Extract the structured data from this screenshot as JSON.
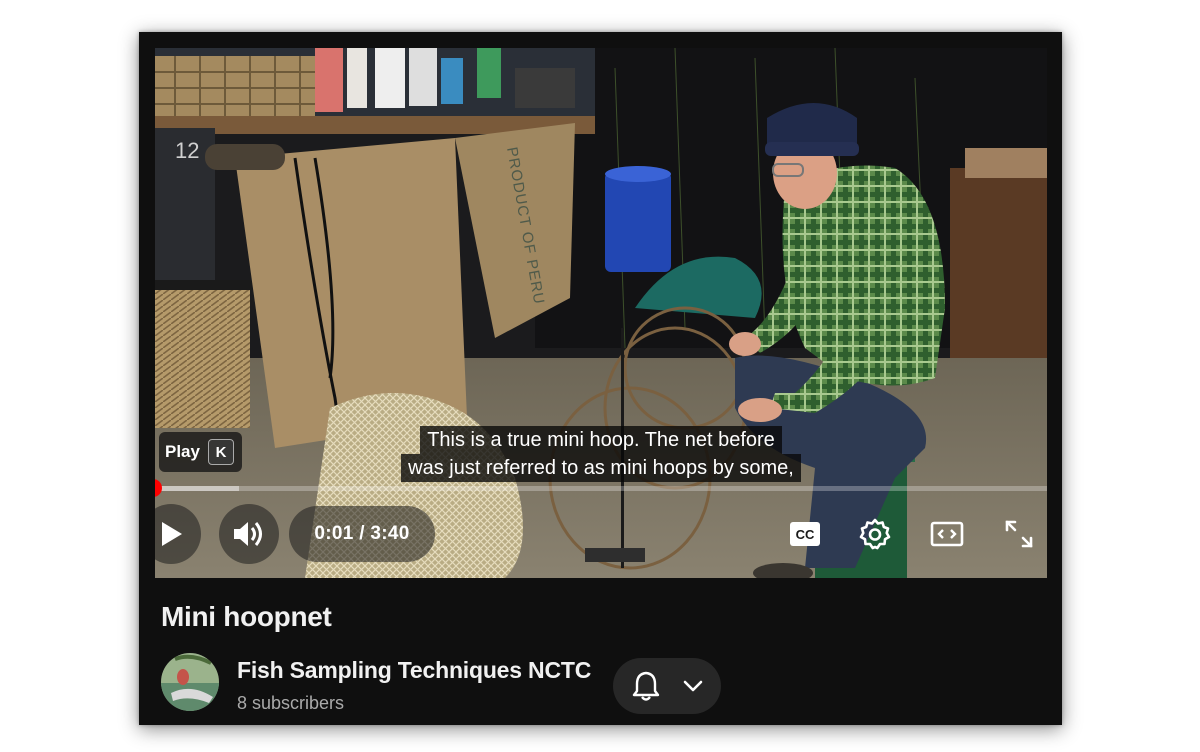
{
  "player": {
    "tooltip": {
      "label": "Play",
      "shortcut": "K"
    },
    "captions": [
      "This is a true mini hoop. The net before",
      "was just referred to as mini hoops by some,"
    ],
    "time": {
      "current": "0:01",
      "duration": "3:40",
      "display": "0:01 / 3:40"
    },
    "progress_fraction": 0.004,
    "buffered_fraction": 0.1,
    "accent_color": "#ff0000",
    "controls": [
      "play-icon",
      "volume-icon",
      "captions-icon",
      "gear-icon",
      "theater-icon",
      "fullscreen-icon"
    ],
    "cc_label": "CC"
  },
  "video": {
    "title": "Mini hoopnet"
  },
  "channel": {
    "name": "Fish Sampling Techniques NCTC",
    "subscribers": "8 subscribers",
    "subscription_icons": [
      "bell-icon",
      "chevron-down-icon"
    ]
  },
  "scene_text": {
    "sack_print": "PRODUCT OF PERU",
    "wall_number": "12"
  }
}
